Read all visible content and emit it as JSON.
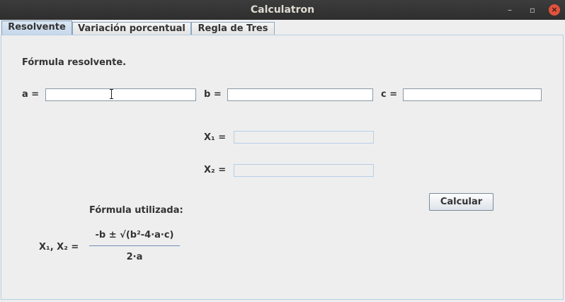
{
  "window": {
    "title": "Calculatron",
    "minimize_glyph": "–",
    "maximize_glyph": "▫",
    "close_glyph": "×"
  },
  "tabs": [
    {
      "label": "Resolvente",
      "active": true
    },
    {
      "label": "Variación porcentual",
      "active": false
    },
    {
      "label": "Regla de Tres",
      "active": false
    }
  ],
  "resolvente": {
    "heading": "Fórmula resolvente.",
    "a_label": "a =",
    "a_value": "",
    "b_label": "b =",
    "b_value": "",
    "c_label": "c =",
    "c_value": "",
    "x1_label": "X₁ =",
    "x1_value": "",
    "x2_label": "X₂ =",
    "x2_value": "",
    "calculate_label": "Calcular",
    "formula_heading": "Fórmula utilizada:",
    "formula_lhs": "X₁, X₂ =",
    "formula_numerator": "-b ± √(b²-4·a·c)",
    "formula_denominator": "2·a"
  },
  "colors": {
    "close_button": "#e0533c",
    "active_tab": "#c7d7ea",
    "panel_border": "#b8cfe5"
  }
}
